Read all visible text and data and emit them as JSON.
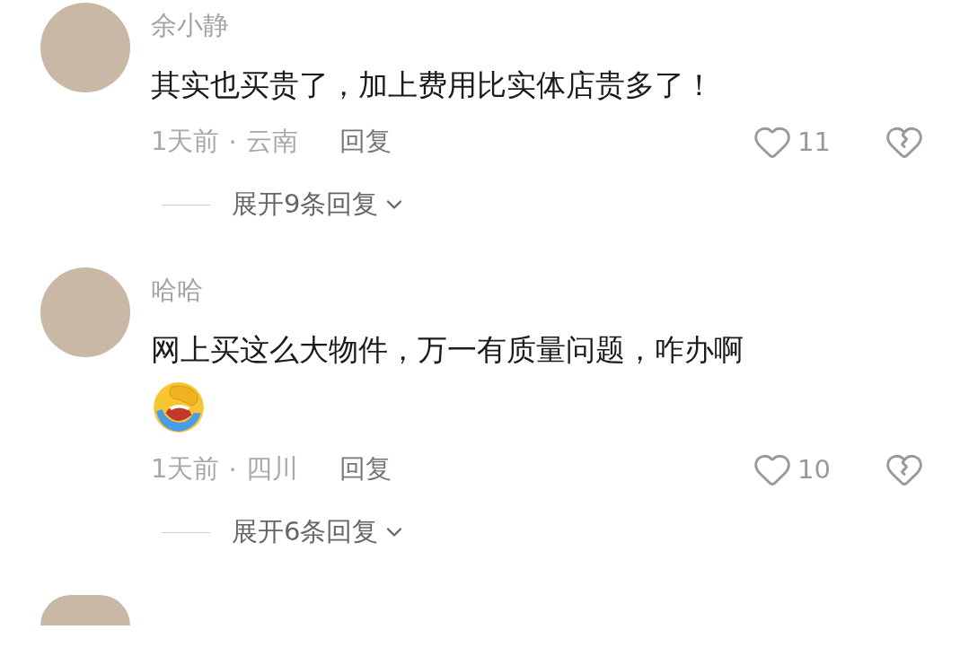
{
  "comments": [
    {
      "name": "余小静",
      "text": "其实也买贵了，加上费用比实体店贵多了！",
      "has_sticker": false,
      "time": "1天前",
      "separator": "·",
      "location": "云南",
      "reply": "回复",
      "likes": "11",
      "expand": "展开9条回复"
    },
    {
      "name": "哈哈",
      "text": "网上买这么大物件，万一有质量问题，咋办啊",
      "has_sticker": true,
      "time": "1天前",
      "separator": "·",
      "location": "四川",
      "reply": "回复",
      "likes": "10",
      "expand": "展开6条回复"
    }
  ]
}
